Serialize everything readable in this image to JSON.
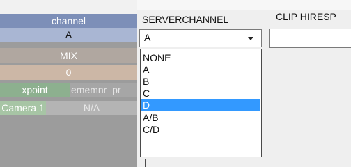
{
  "left_panel": {
    "channel_label": "channel",
    "channel_value": "A",
    "mix_label": "MIX",
    "mix_value": "0",
    "xpoint_label": "xpoint",
    "xpoint_value": "ememnr_pr",
    "camera_label": "Camera 1",
    "camera_value": "N/A"
  },
  "server_channel": {
    "header": "SERVERCHANNEL",
    "selected": "A",
    "options": [
      "NONE",
      "A",
      "B",
      "C",
      "D",
      "A/B",
      "C/D"
    ],
    "highlighted": "D"
  },
  "clip": {
    "header": "CLIP HIRESP"
  },
  "colors": {
    "highlight": "#3399ff",
    "channel_header": "#7d8fb8",
    "xpoint_label": "#8db08f"
  }
}
